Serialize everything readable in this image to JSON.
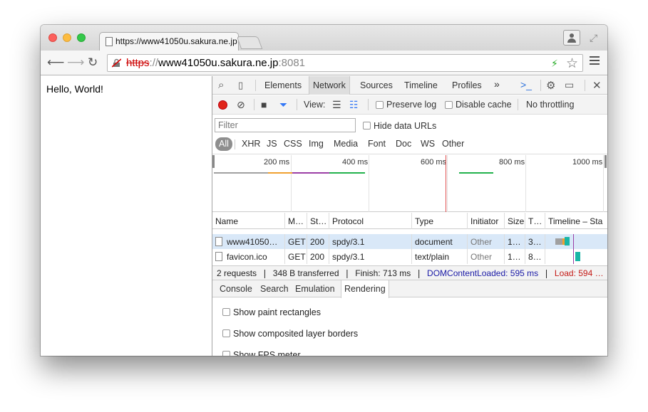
{
  "browser": {
    "tab_title": "https://www41050u.sakura.ne.jp",
    "url": {
      "protocol": "https",
      "separator": "://",
      "host": "www41050u.sakura.ne.jp",
      "port": ":8081"
    }
  },
  "page": {
    "content": "Hello, World!"
  },
  "devtools": {
    "tabs": [
      "Elements",
      "Network",
      "Sources",
      "Timeline",
      "Profiles"
    ],
    "more_tabs": "»",
    "active_tab": "Network",
    "controls": {
      "view_label": "View:",
      "preserve_log": "Preserve log",
      "disable_cache": "Disable cache",
      "throttling": "No throttling"
    },
    "filter": {
      "placeholder": "Filter",
      "hide_data_urls": "Hide data URLs"
    },
    "type_filters": [
      "All",
      "XHR",
      "JS",
      "CSS",
      "Img",
      "Media",
      "Font",
      "Doc",
      "WS",
      "Other"
    ],
    "overview_ticks": [
      "200 ms",
      "400 ms",
      "600 ms",
      "800 ms",
      "1000 ms"
    ],
    "table": {
      "columns": [
        "Name",
        "M…",
        "St…",
        "Protocol",
        "Type",
        "Initiator",
        "Size",
        "T…",
        "Timeline – Sta"
      ],
      "rows": [
        {
          "name": "www41050…",
          "method": "GET",
          "status": "200",
          "protocol": "spdy/3.1",
          "type": "document",
          "initiator": "Other",
          "size": "1…",
          "time": "3…"
        },
        {
          "name": "favicon.ico",
          "method": "GET",
          "status": "200",
          "protocol": "spdy/3.1",
          "type": "text/plain",
          "initiator": "Other",
          "size": "1…",
          "time": "8…"
        }
      ]
    },
    "summary": {
      "requests": "2 requests",
      "transferred": "348 B transferred",
      "finish": "Finish: 713 ms",
      "dom_content_loaded": "DOMContentLoaded: 595 ms",
      "load": "Load: 594 …",
      "divider": "❘"
    },
    "drawer": {
      "tabs": [
        "Console",
        "Search",
        "Emulation",
        "Rendering"
      ],
      "active_tab": "Rendering",
      "options": [
        "Show paint rectangles",
        "Show composited layer borders",
        "Show FPS meter"
      ]
    }
  },
  "colors": {
    "record": "#e0241a",
    "active_filter": "#3478f6",
    "dom_content_loaded": "#1a1aa6",
    "load": "#c41a16"
  }
}
